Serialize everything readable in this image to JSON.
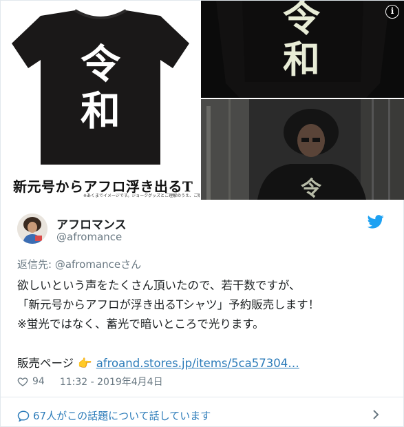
{
  "media": {
    "left_caption": "新元号からアフロ浮き出るT",
    "left_fineprint": "※あくまでイメージです。ジョークグッズとご理解のうえ、ご購入ください。",
    "shirt_kanji_top": "令",
    "shirt_kanji_bottom": "和",
    "info_label": "i"
  },
  "author": {
    "name": "アフロマンス",
    "handle": "@afromance"
  },
  "tweet": {
    "reply_prefix": "返信先: ",
    "reply_mention": "@afromance",
    "reply_suffix": "さん",
    "line1": "欲しいという声をたくさん頂いたので、若干数ですが、",
    "line2": "「新元号からアフロが浮き出るTシャツ」予約販売します！",
    "line3": "※蛍光ではなく、蓄光で暗いところで光ります。",
    "line5_prefix": "販売ページ",
    "line5_emoji": "👉",
    "link_text": "afroand.stores.jp/items/5ca57304…"
  },
  "meta": {
    "likes": "94",
    "timestamp": "11:32 - 2019年4月4日"
  },
  "conversation": {
    "label": "67人がこの話題について話しています"
  },
  "colors": {
    "link": "#2b7bb9",
    "muted": "#697882",
    "twitter_blue": "#1da1f2",
    "shirt": "#1a1818",
    "glow": "#e8ecd6"
  }
}
